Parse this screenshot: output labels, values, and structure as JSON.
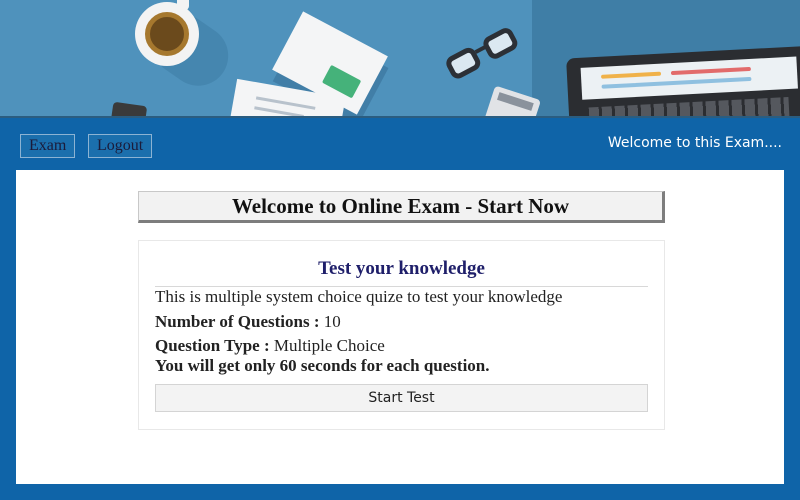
{
  "nav": {
    "exam_label": "Exam",
    "logout_label": "Logout",
    "welcome_text": "Welcome to this Exam...."
  },
  "main": {
    "heading": "Welcome to Online Exam - Start Now",
    "panel_title": "Test your knowledge",
    "description": "This is multiple system choice quize to test your knowledge",
    "questions_label": "Number of Questions :",
    "questions_value": "10",
    "type_label": "Question Type :",
    "type_value": "Multiple Choice",
    "time_note": "You will get only 60 seconds for each question.",
    "start_label": "Start Test"
  },
  "colors": {
    "page_bg": "#0f64a8",
    "banner_bg": "#4f92bc",
    "title_color": "#1f1f6a"
  }
}
